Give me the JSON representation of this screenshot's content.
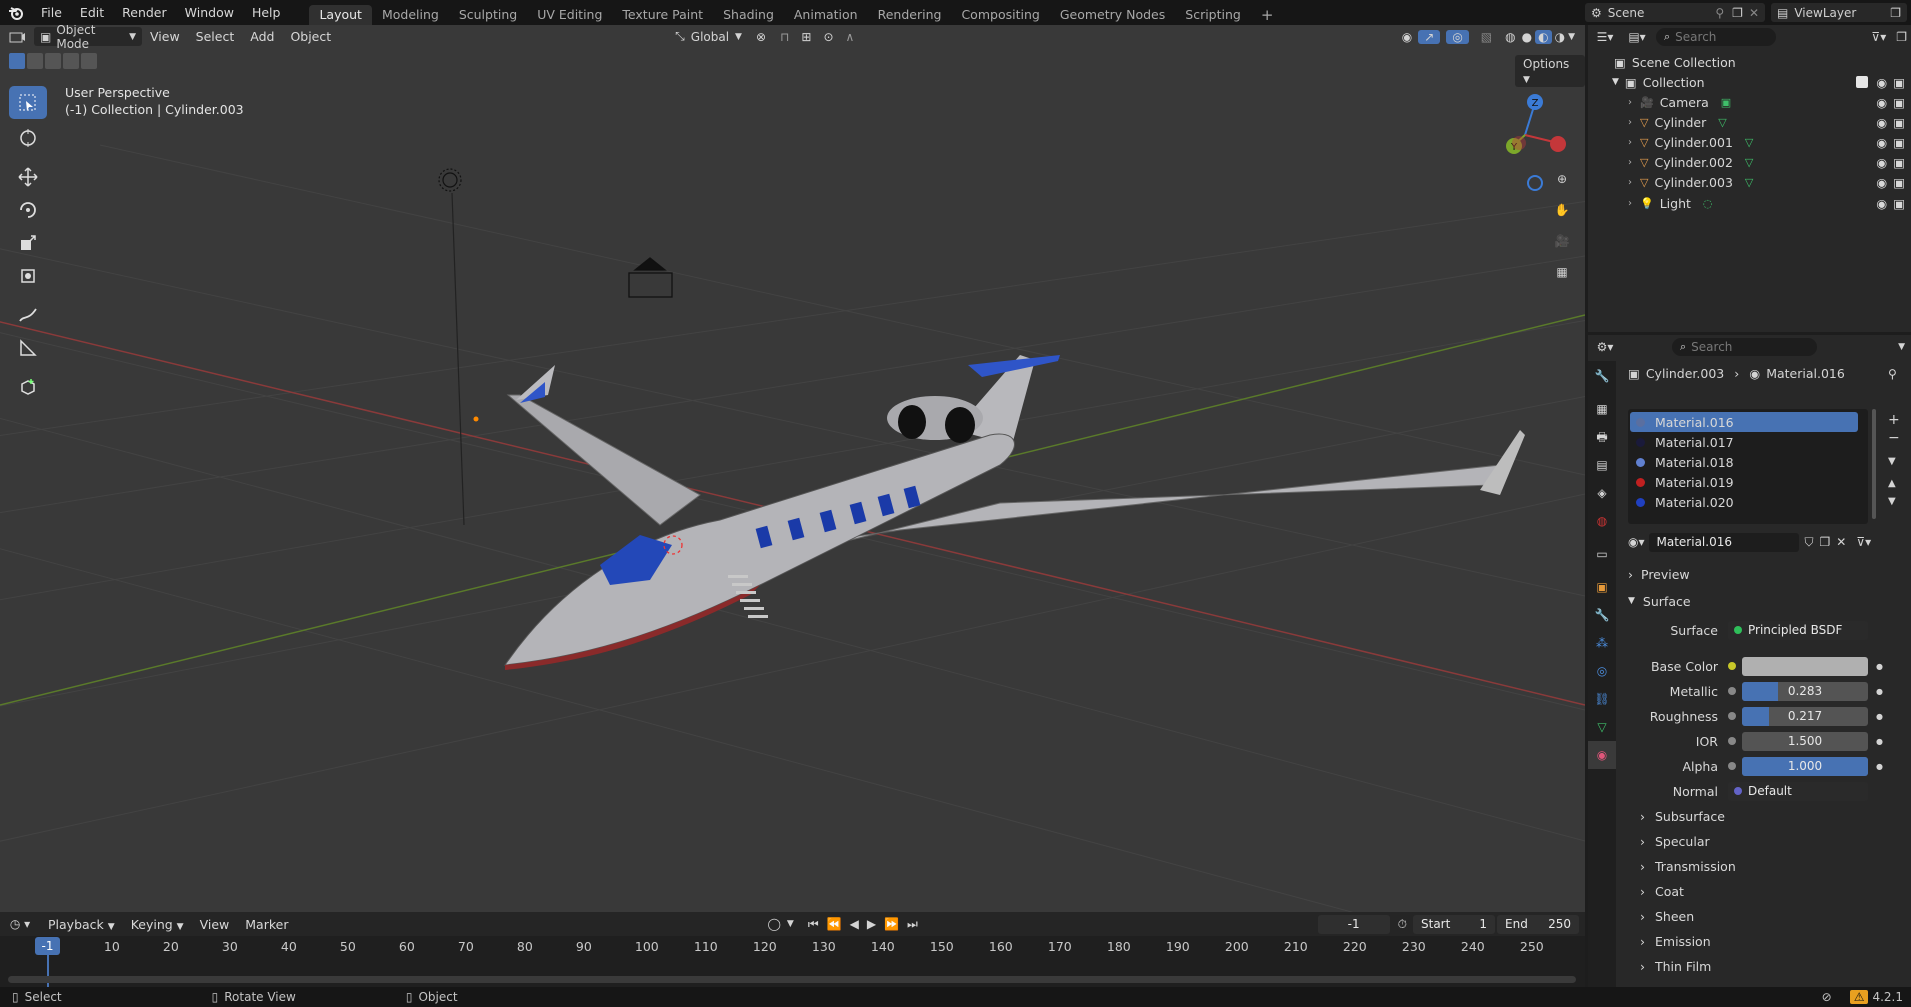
{
  "menu": {
    "file": "File",
    "edit": "Edit",
    "render": "Render",
    "window": "Window",
    "help": "Help"
  },
  "workspaces": [
    "Layout",
    "Modeling",
    "Sculpting",
    "UV Editing",
    "Texture Paint",
    "Shading",
    "Animation",
    "Rendering",
    "Compositing",
    "Geometry Nodes",
    "Scripting"
  ],
  "scene": {
    "scene_name": "Scene",
    "view_layer": "ViewLayer"
  },
  "viewport": {
    "mode": "Object Mode",
    "menus": [
      "View",
      "Select",
      "Add",
      "Object"
    ],
    "transform": "Global",
    "options": "Options",
    "overlay_title": "User Perspective",
    "overlay_sub": "(-1) Collection | Cylinder.003"
  },
  "outliner": {
    "search_placeholder": "Search",
    "scene_collection": "Scene Collection",
    "collection": "Collection",
    "items": [
      {
        "name": "Camera",
        "type": "camera"
      },
      {
        "name": "Cylinder",
        "type": "mesh"
      },
      {
        "name": "Cylinder.001",
        "type": "mesh"
      },
      {
        "name": "Cylinder.002",
        "type": "mesh"
      },
      {
        "name": "Cylinder.003",
        "type": "mesh"
      },
      {
        "name": "Light",
        "type": "light"
      }
    ]
  },
  "properties": {
    "search_placeholder": "Search",
    "breadcrumb_object": "Cylinder.003",
    "breadcrumb_material": "Material.016",
    "material_slots": [
      {
        "name": "Material.016",
        "color": "#5a6fa0"
      },
      {
        "name": "Material.017",
        "color": "#1a1a3a"
      },
      {
        "name": "Material.018",
        "color": "#6080d0"
      },
      {
        "name": "Material.019",
        "color": "#c02020"
      },
      {
        "name": "Material.020",
        "color": "#2040c0"
      }
    ],
    "active_material": "Material.016",
    "preview": "Preview",
    "surface_panel": "Surface",
    "surface_label": "Surface",
    "surface_value": "Principled BSDF",
    "base_color_label": "Base Color",
    "base_color": "#b0b0b0",
    "metallic_label": "Metallic",
    "metallic": "0.283",
    "metallic_fraction": 0.283,
    "roughness_label": "Roughness",
    "roughness": "0.217",
    "roughness_fraction": 0.217,
    "ior_label": "IOR",
    "ior": "1.500",
    "alpha_label": "Alpha",
    "alpha": "1.000",
    "alpha_fraction": 1.0,
    "normal_label": "Normal",
    "normal": "Default",
    "subpanels": [
      "Subsurface",
      "Specular",
      "Transmission",
      "Coat",
      "Sheen",
      "Emission",
      "Thin Film"
    ]
  },
  "timeline": {
    "menus": [
      "Playback",
      "Keying",
      "View",
      "Marker"
    ],
    "current_frame": "-1",
    "start_label": "Start",
    "start": "1",
    "end_label": "End",
    "end": "250",
    "ticks": [
      "-1",
      "10",
      "20",
      "30",
      "40",
      "50",
      "60",
      "70",
      "80",
      "90",
      "100",
      "110",
      "120",
      "130",
      "140",
      "150",
      "160",
      "170",
      "180",
      "190",
      "200",
      "210",
      "220",
      "230",
      "240",
      "250"
    ]
  },
  "status": {
    "select": "Select",
    "rotate": "Rotate View",
    "object": "Object",
    "version": "4.2.1"
  },
  "colors": {
    "accent": "#4772b3",
    "active_tab": "#303030"
  }
}
